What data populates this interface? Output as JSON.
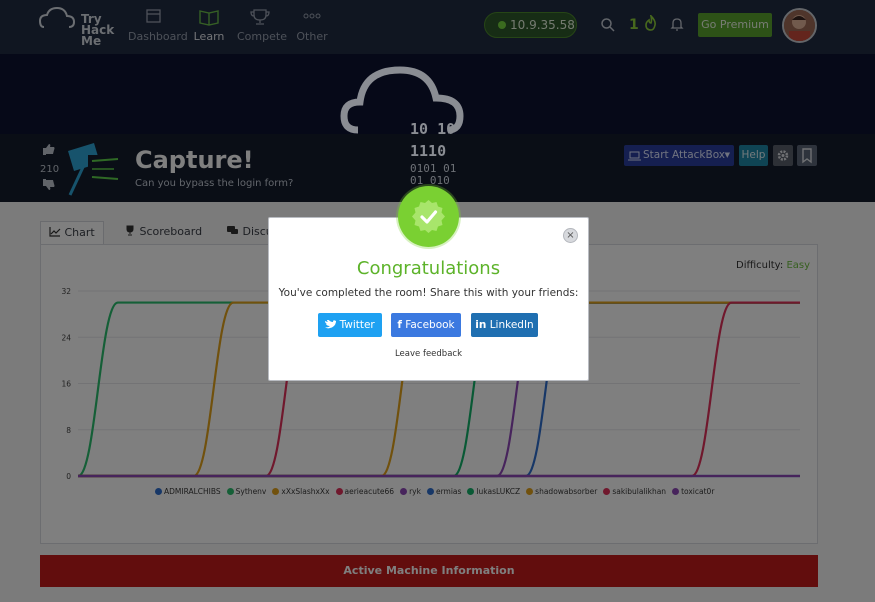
{
  "nav": {
    "logo_lines": [
      "Try",
      "Hack",
      "Me"
    ],
    "items": [
      {
        "label": "Dashboard",
        "icon": "dashboard-icon"
      },
      {
        "label": "Learn",
        "icon": "book-icon"
      },
      {
        "label": "Compete",
        "icon": "trophy-icon"
      },
      {
        "label": "Other",
        "icon": "dots-icon"
      }
    ],
    "ip": "10.9.35.58",
    "streak": "1",
    "premium_label": "Go Premium"
  },
  "room": {
    "votes": "210",
    "title": "Capture!",
    "subtitle": "Can you bypass the login form?",
    "attackbox_label": "Start AttackBox",
    "help_label": "Help"
  },
  "tabs": {
    "chart": "Chart",
    "scoreboard": "Scoreboard",
    "discuss": "Discu"
  },
  "chart": {
    "difficulty_label": "Difficulty:",
    "difficulty_value": "Easy",
    "y_ticks": [
      "0",
      "8",
      "16",
      "24",
      "32"
    ]
  },
  "chart_data": {
    "type": "line",
    "title": "",
    "ylim": [
      0,
      32
    ],
    "yticks": [
      0,
      8,
      16,
      24,
      32
    ],
    "series": [
      {
        "name": "ADMIRALCHIBS",
        "color": "#2f6fcf",
        "values": [
          0,
          0
        ]
      },
      {
        "name": "Sythenv",
        "color": "#2bbf6e",
        "values": [
          0,
          30
        ]
      },
      {
        "name": "xXxSlashxXx",
        "color": "#e3a21a",
        "values": [
          0,
          30
        ]
      },
      {
        "name": "aerieacute66",
        "color": "#e0305a",
        "values": [
          0,
          30
        ]
      },
      {
        "name": "ryk",
        "color": "#8f48b8",
        "values": [
          0,
          30
        ]
      },
      {
        "name": "ermias",
        "color": "#2f6fcf",
        "values": [
          0,
          30
        ]
      },
      {
        "name": "lukasLUKCZ",
        "color": "#12b36a",
        "values": [
          0,
          30
        ]
      },
      {
        "name": "shadowabsorber",
        "color": "#e3a21a",
        "values": [
          0,
          30
        ]
      },
      {
        "name": "sakibulalikhan",
        "color": "#e0305a",
        "values": [
          0,
          30
        ]
      },
      {
        "name": "toxicat0r",
        "color": "#8f48b8",
        "values": [
          0,
          0
        ]
      }
    ],
    "legend_position": "bottom"
  },
  "modal": {
    "title": "Congratulations",
    "text": "You've completed the room! Share this with your friends:",
    "twitter": "Twitter",
    "facebook": "Facebook",
    "linkedin": "LinkedIn",
    "feedback": "Leave feedback",
    "close": "×"
  },
  "active_machine": "Active Machine Information",
  "colors": {
    "nav_bg": "#212c42",
    "accent_green": "#5aa52f",
    "modal_green": "#5db32a",
    "red_banner": "#c51b1b"
  }
}
